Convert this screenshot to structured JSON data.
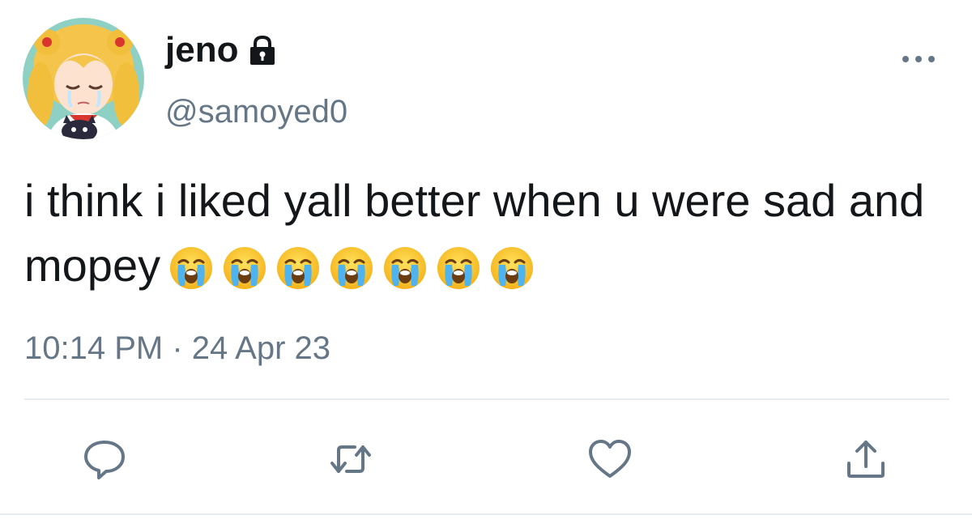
{
  "tweet": {
    "author": {
      "display_name": "jeno",
      "handle": "@samoyed0",
      "protected_icon": "lock-icon",
      "avatar": "anime-character-crying-avatar"
    },
    "text": "i think i liked yall better when u were sad and mopey",
    "emojis": [
      "😭",
      "😭",
      "😭",
      "😭",
      "😭",
      "😭",
      "😭"
    ],
    "timestamp": "10:14 PM · 24 Apr 23"
  },
  "actions": [
    {
      "name": "reply",
      "icon": "reply-icon"
    },
    {
      "name": "retweet",
      "icon": "retweet-icon"
    },
    {
      "name": "like",
      "icon": "heart-icon"
    },
    {
      "name": "share",
      "icon": "share-icon"
    }
  ],
  "colors": {
    "text_primary": "#14171a",
    "text_secondary": "#657786",
    "icon": "#657786",
    "divider": "#e6ecf0"
  }
}
